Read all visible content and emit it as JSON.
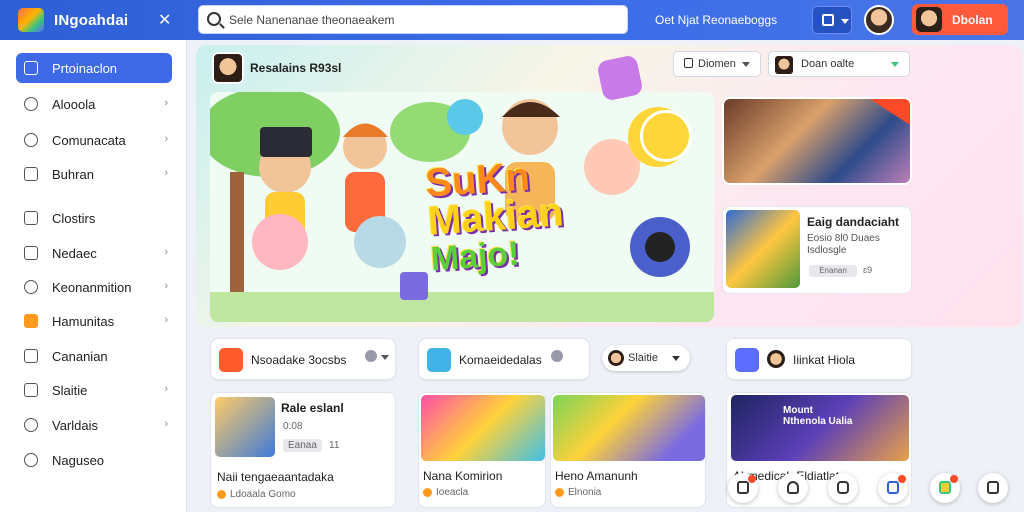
{
  "header": {
    "app_title": "INgoahdai",
    "close_symbol": "✕",
    "search": {
      "value": "Sele Nanenanae theonaeakem"
    },
    "top_link": "Oet Njat Reonaeboggs",
    "cta_label": "Dbolan"
  },
  "sidebar": {
    "items": [
      {
        "label": "Prtoinaclon",
        "active": true,
        "chevron": false,
        "icon": "window-icon"
      },
      {
        "label": "Alooola",
        "chevron": true,
        "icon": "pen-icon"
      },
      {
        "label": "Comunacata",
        "chevron": true,
        "icon": "pen-icon"
      },
      {
        "label": "Buhran",
        "chevron": true,
        "icon": "document-icon"
      },
      {
        "label": "Clostirs",
        "chevron": false,
        "icon": "document-icon"
      },
      {
        "label": "Nedaec",
        "chevron": true,
        "icon": "grid-icon"
      },
      {
        "label": "Keonanmition",
        "chevron": true,
        "icon": "pen-icon"
      },
      {
        "label": "Hamunitas",
        "chevron": true,
        "icon": "checkbox-icon"
      },
      {
        "label": "Cananian",
        "chevron": false,
        "icon": "list-icon"
      },
      {
        "label": "Slaitie",
        "chevron": true,
        "icon": "document-icon"
      },
      {
        "label": "Varldais",
        "chevron": true,
        "icon": "pen-icon"
      },
      {
        "label": "Naguseo",
        "chevron": false,
        "icon": "gear-icon"
      }
    ]
  },
  "hero": {
    "tag": "Resalains R93sl",
    "select1": "Diomen",
    "select2": "Doan oalte",
    "title_lines": [
      "SuKn",
      "Makian",
      "Majo!"
    ],
    "side_card": {
      "title": "Eaig dandaciaht",
      "sub": "Eosio 8l0 Duaes Isdlosgle",
      "pill": "Enanan",
      "num": "ɛ9"
    }
  },
  "sections": [
    {
      "label": "Nsoadake 3ocsbs",
      "icon_color": "#ff5a2a"
    },
    {
      "label": "Komaeidedalas",
      "icon_color": "#3fb3e8",
      "pill": "Slaitie"
    },
    {
      "label": "Iiinkat Hiola",
      "icon_color": "#5b6cff"
    }
  ],
  "cards": [
    {
      "title": "Naii tengaeaantadaka",
      "head": "Rale eslanl",
      "meta": "Eanaa",
      "num": "11",
      "meta2": "0:08",
      "footer": "Ldoaala  Gomo"
    },
    {
      "title": "Nana Komirion",
      "meta": "Ioeacla"
    },
    {
      "title": "Heno Amanunh",
      "meta": "Elnonia"
    },
    {
      "title": "Ahmedicah Eldiatlat",
      "banner": "Mount Nthenola Ualia"
    }
  ],
  "bottom_icons": [
    "message-icon",
    "bell-icon",
    "chat-icon",
    "shield-icon",
    "game-icon",
    "window-icon"
  ]
}
